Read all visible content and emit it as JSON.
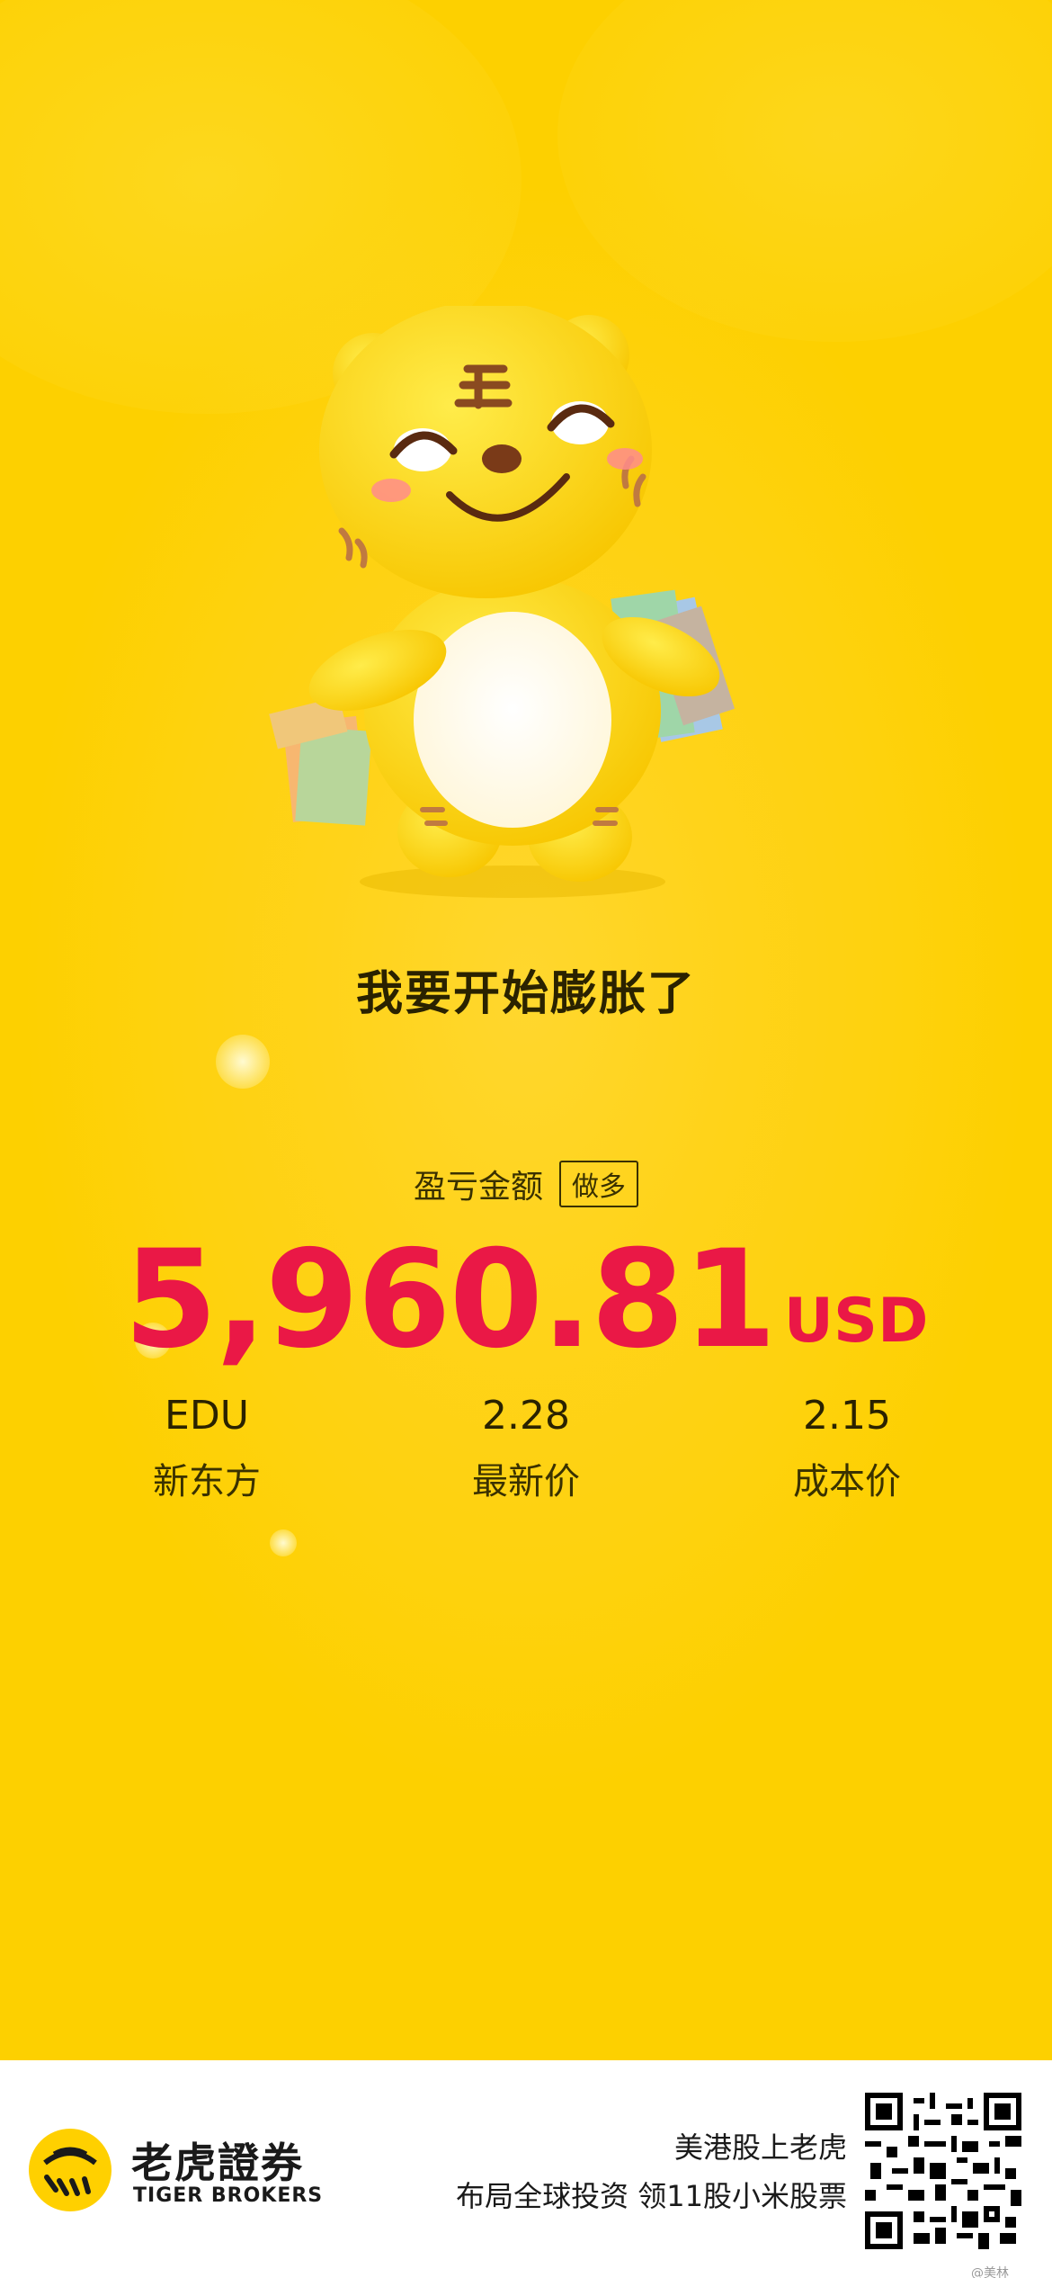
{
  "slogan": "我要开始膨胀了",
  "profit": {
    "label": "盈亏金额",
    "tag": "做多",
    "amount": "5,960.81",
    "currency": "USD"
  },
  "stats": [
    {
      "value": "EDU",
      "label": "新东方"
    },
    {
      "value": "2.28",
      "label": "最新价"
    },
    {
      "value": "2.15",
      "label": "成本价"
    }
  ],
  "footer": {
    "brand_cn": "老虎證券",
    "brand_en": "TIGER BROKERS",
    "promo_line1": "美港股上老虎",
    "promo_line2": "布局全球投资 领11股小米股票",
    "qr_caption": "@美林"
  },
  "colors": {
    "background": "#fdd000",
    "amount": "#ea1846",
    "text": "#2a2200"
  },
  "icons": {
    "mascot": "tiger-mascot-with-shopping-bags",
    "logo": "tiger-brokers-logo-icon",
    "qr": "qr-code"
  }
}
